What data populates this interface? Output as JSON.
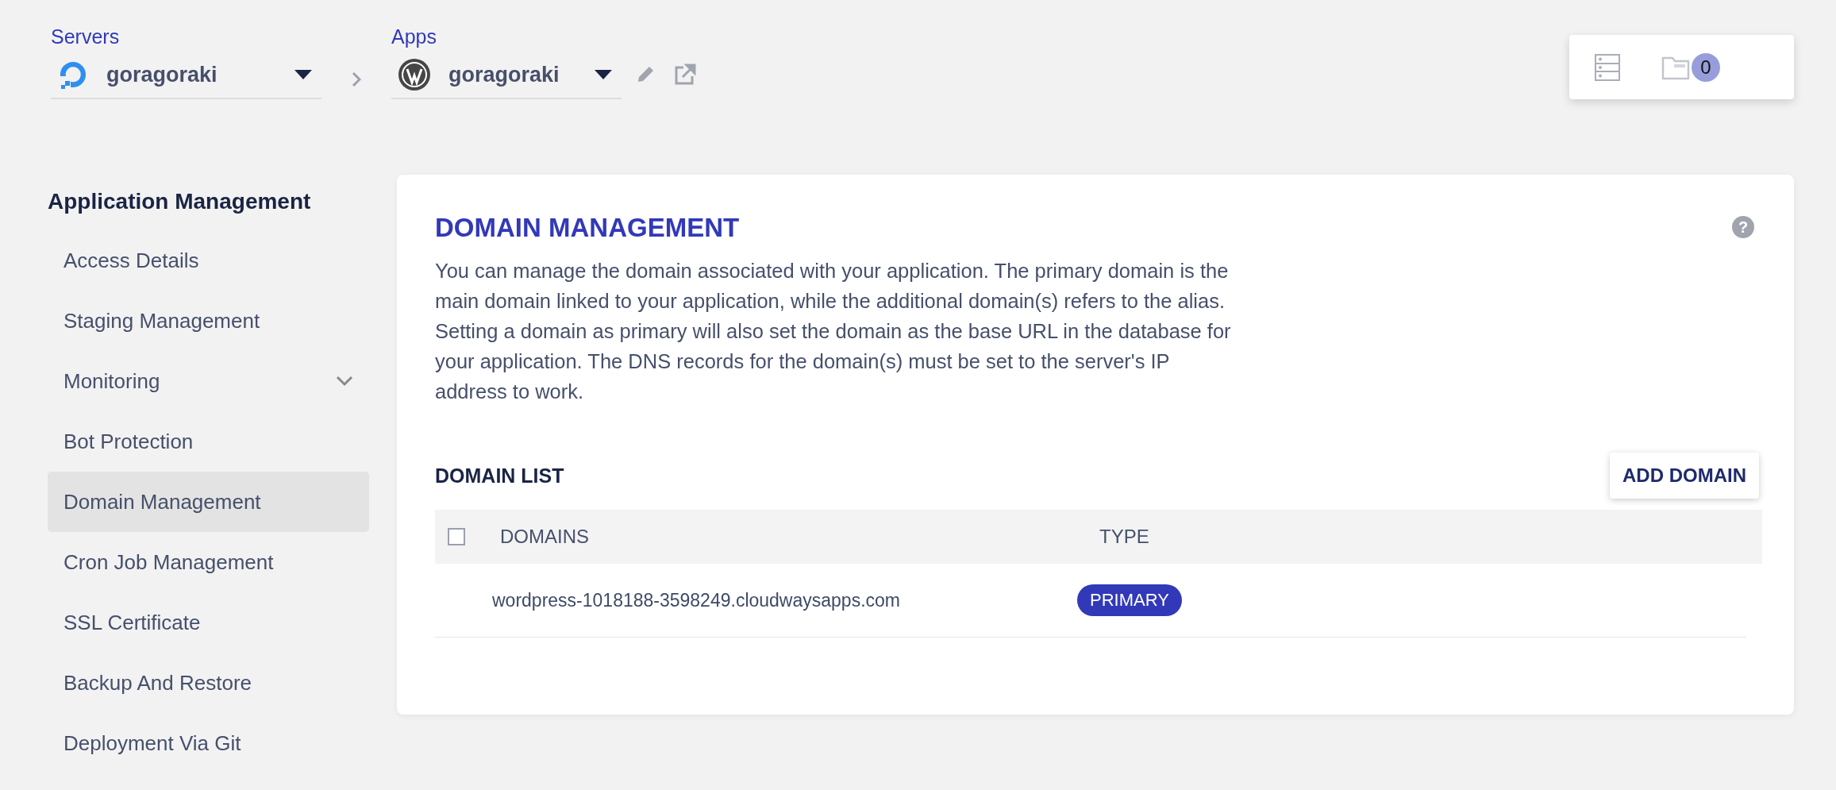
{
  "servers": {
    "label": "Servers",
    "value": "goragoraki"
  },
  "apps": {
    "label": "Apps",
    "value": "goragoraki"
  },
  "notifications": {
    "count": "0"
  },
  "sidebar": {
    "heading": "Application Management",
    "items": [
      {
        "label": "Access Details",
        "selected": false
      },
      {
        "label": "Staging Management",
        "selected": false
      },
      {
        "label": "Monitoring",
        "selected": false,
        "expandable": true
      },
      {
        "label": "Bot Protection",
        "selected": false
      },
      {
        "label": "Domain Management",
        "selected": true
      },
      {
        "label": "Cron Job Management",
        "selected": false
      },
      {
        "label": "SSL Certificate",
        "selected": false
      },
      {
        "label": "Backup And Restore",
        "selected": false
      },
      {
        "label": "Deployment Via Git",
        "selected": false
      }
    ]
  },
  "panel": {
    "title": "DOMAIN MANAGEMENT",
    "help": "?",
    "description": "You can manage the domain associated with your application. The primary domain is the main domain linked to your application, while the additional domain(s) refers to the alias. Setting a domain as primary will also set the domain as the base URL in the database for your application. The DNS records for the domain(s) must be set to the server's IP address to work.",
    "list_title": "DOMAIN LIST",
    "add_button": "ADD DOMAIN",
    "table": {
      "select_all_checked": false,
      "columns": [
        "DOMAINS",
        "TYPE"
      ],
      "rows": [
        {
          "domain": "wordpress-1018188-3598249.cloudwaysapps.com",
          "type": "PRIMARY"
        }
      ]
    }
  }
}
